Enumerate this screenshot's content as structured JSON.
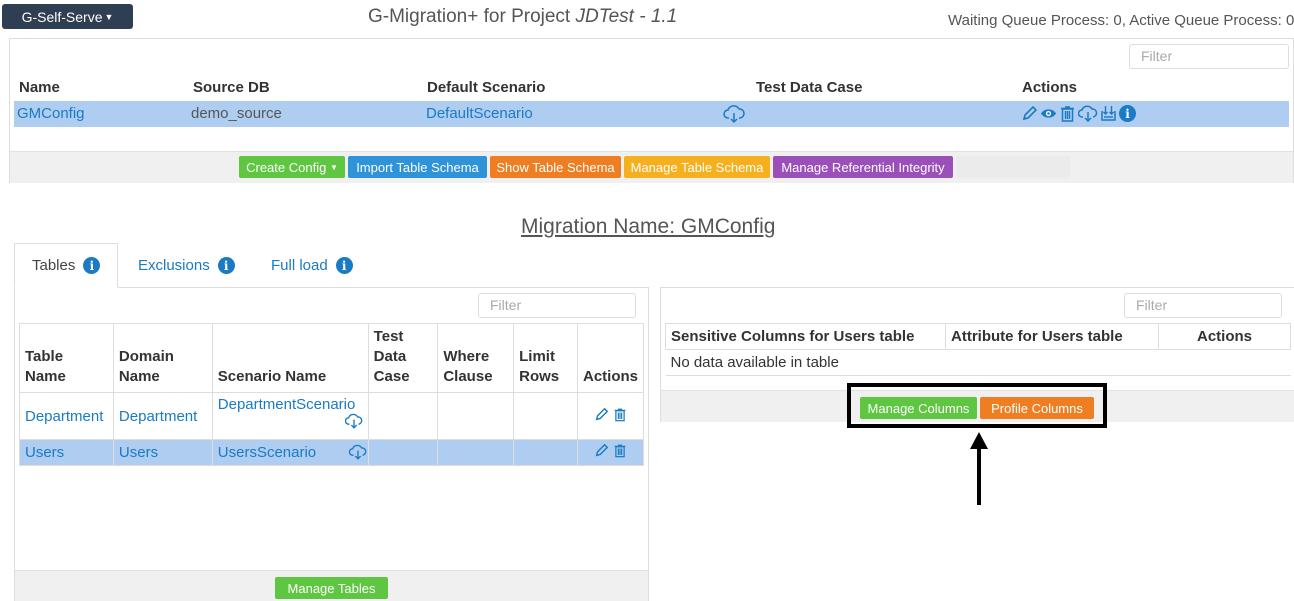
{
  "header": {
    "brand_button": "G-Self-Serve",
    "title_prefix": "G-Migration+ for Project ",
    "project_name": "JDTest - 1.1",
    "queue_status": "Waiting Queue Process: 0, Active Queue Process: 0"
  },
  "config": {
    "filter_placeholder": "Filter",
    "columns": [
      "Name",
      "Source DB",
      "Default Scenario",
      "Test Data Case",
      "Actions"
    ],
    "row": {
      "name": "GMConfig",
      "source_db": "demo_source",
      "default_scenario": "DefaultScenario",
      "test_data_icon": "cloud-download-icon",
      "action_icons": [
        "pencil-icon",
        "eye-icon",
        "trash-icon",
        "cloud-download-icon",
        "database-import-icon",
        "info-icon"
      ]
    },
    "buttons": {
      "create_config": "Create Config",
      "import_schema": "Import Table Schema",
      "show_schema": "Show Table Schema",
      "manage_schema": "Manage Table Schema",
      "ref_integrity": "Manage Referential Integrity"
    }
  },
  "migration_title": "Migration Name: GMConfig",
  "tabs": [
    {
      "label": "Tables"
    },
    {
      "label": "Exclusions"
    },
    {
      "label": "Full load"
    }
  ],
  "tables_panel": {
    "filter_placeholder": "Filter",
    "columns": [
      "Table Name",
      "Domain Name",
      "Scenario Name",
      "Test Data Case",
      "Where Clause",
      "Limit Rows",
      "Actions"
    ],
    "rows": [
      {
        "table": "Department",
        "domain": "Department",
        "scenario": "DepartmentScenario"
      },
      {
        "table": "Users",
        "domain": "Users",
        "scenario": "UsersScenario"
      }
    ],
    "manage_tables": "Manage Tables"
  },
  "sensitive_panel": {
    "filter_placeholder": "Filter",
    "columns": [
      "Sensitive Columns for Users table",
      "Attribute for Users table",
      "Actions"
    ],
    "empty_text": "No data available in table",
    "manage_columns": "Manage Columns",
    "profile_columns": "Profile Columns"
  },
  "colors": {
    "selected_row": "#aecdf0",
    "link": "#1a7ac4",
    "green": "#5ec640",
    "blue": "#2f93d8",
    "orange": "#ef7d22",
    "yellow": "#f6b01e",
    "purple": "#9b4fb8"
  }
}
